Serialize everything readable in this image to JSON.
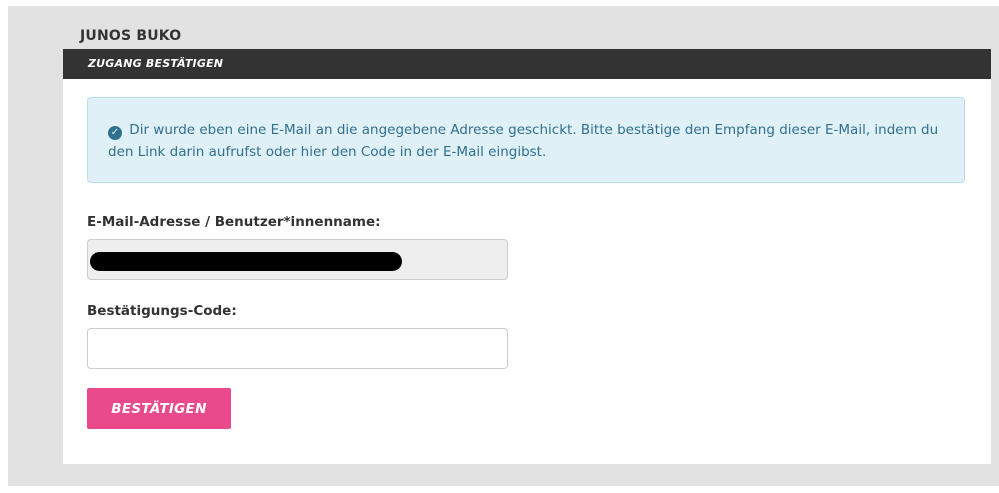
{
  "site": {
    "title": "JUNOS BUKO"
  },
  "header": {
    "title": "ZUGANG BESTÄTIGEN"
  },
  "alert": {
    "icon": "check-circle-icon",
    "message": "Dir wurde eben eine E-Mail an die angegebene Adresse geschickt. Bitte bestätige den Empfang dieser E-Mail, indem du den Link darin aufrufst oder hier den Code in der E-Mail eingibst."
  },
  "form": {
    "email_label": "E-Mail-Adresse / Benutzer*innenname:",
    "code_label": "Bestätigungs-Code:",
    "code_value": "",
    "submit_label": "BESTÄTIGEN"
  },
  "colors": {
    "header_bar": "#333333",
    "alert_bg": "#dff0f7",
    "alert_text": "#31708f",
    "submit_button": "#e84a8b",
    "page_frame": "#e2e2e2"
  }
}
